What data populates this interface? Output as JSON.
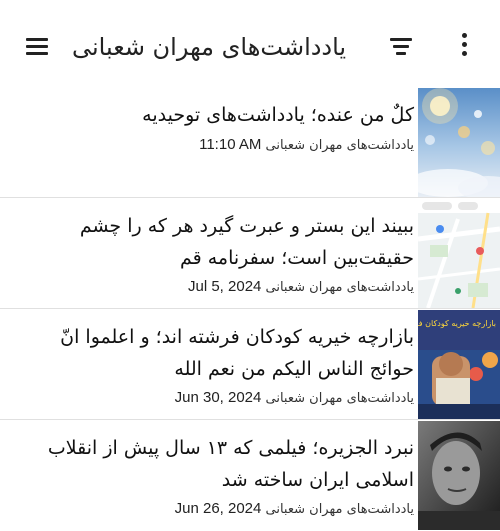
{
  "appbar": {
    "title": "یادداشت‌های مهران شعبانی",
    "menu_icon": "hamburger-menu-icon",
    "filter_icon": "filter-sort-icon",
    "more_icon": "more-vertical-icon"
  },
  "posts": [
    {
      "title": "کلٌ من عنده؛ یادداشت‌های توحیدیه",
      "author": "یادداشت‌های مهران شعبانی",
      "date": "11:10 AM",
      "thumbnail": "sky-lights-image"
    },
    {
      "title": "ببیند این بستر و عبرت گیرد هر که را چشم حقیقت‌بین است؛ سفرنامه قم",
      "author": "یادداشت‌های مهران شعبانی",
      "date": "Jul 5, 2024",
      "thumbnail": "map-screenshot-image"
    },
    {
      "title": "بازارچه خیریه کودکان فرشته اند؛ و اعلموا انّ حوائج الناس الیکم من نعم الله",
      "author": "یادداشت‌های مهران شعبانی",
      "date": "Jun 30, 2024",
      "thumbnail": "charity-bazaar-poster-image",
      "thumbnail_text": "بازارچه خیریه کودکان فرشته اند"
    },
    {
      "title": "نبرد الجزیره؛ فیلمی که ۱۳ سال پیش از انقلاب اسلامی ایران ساخته شد",
      "author": "یادداشت‌های مهران شعبانی",
      "date": "Jun 26, 2024",
      "thumbnail": "film-still-portrait-image"
    }
  ]
}
